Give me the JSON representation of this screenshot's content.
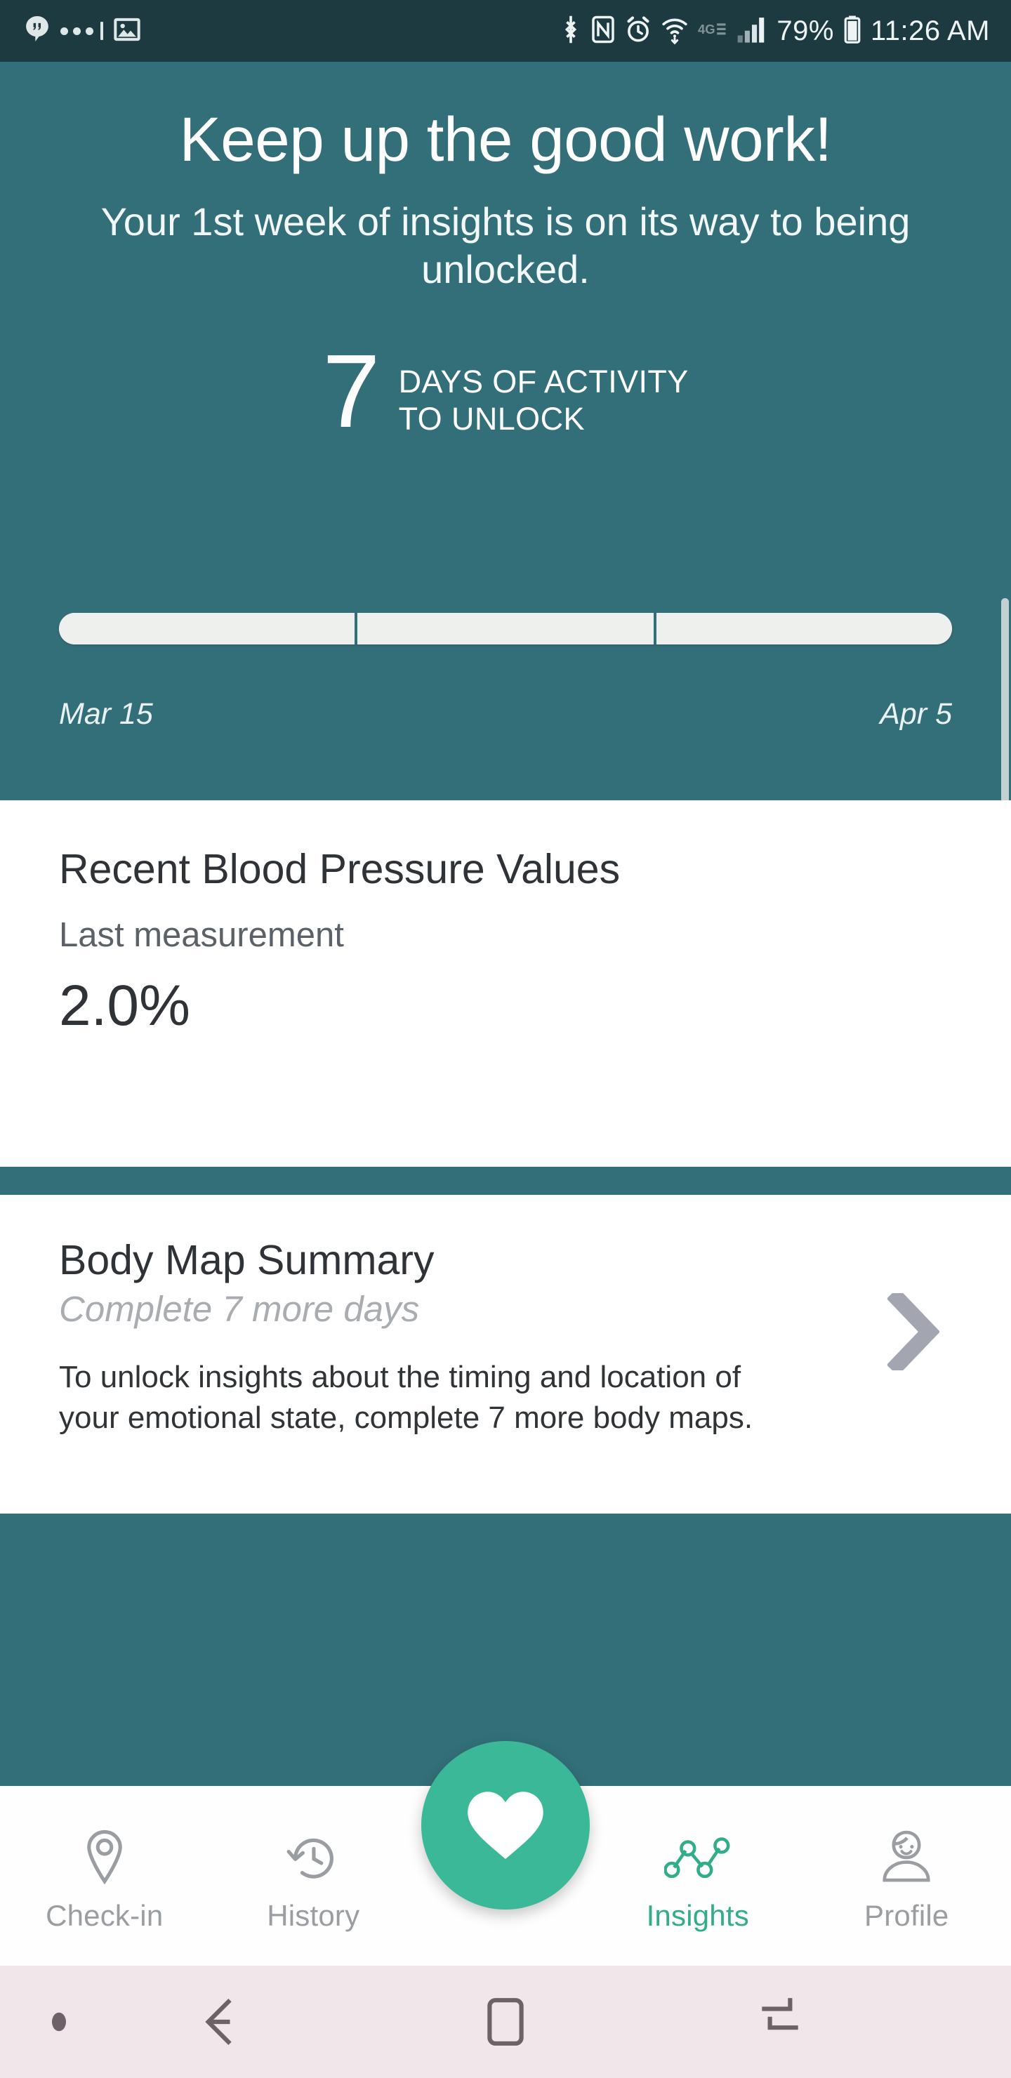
{
  "status_bar": {
    "left_icons": [
      "hangouts-icon",
      "more-dots-icon",
      "gallery-icon"
    ],
    "right_icons": [
      "bluetooth-icon",
      "nfc-icon",
      "alarm-icon",
      "wifi-icon",
      "lte-icon",
      "signal-icon",
      "battery-icon"
    ],
    "network_label": "4G",
    "battery_percent": "79%",
    "clock": "11:26 AM",
    "background_color": "#1d3a40"
  },
  "hero": {
    "title": "Keep up the good work!",
    "subtitle": "Your 1st week of insights is on its way to being unlocked.",
    "unlock_number": "7",
    "unlock_caption_line1": "DAYS OF ACTIVITY",
    "unlock_caption_line2": "TO UNLOCK",
    "progress": {
      "segments": 3,
      "filled": 0,
      "percent": 0,
      "start_date": "Mar 15",
      "end_date": "Apr 5"
    },
    "background_color": "#336f78"
  },
  "cards": {
    "blood_pressure": {
      "title": "Recent Blood Pressure Values",
      "subtitle": "Last measurement",
      "value": "2.0%"
    },
    "body_map": {
      "title": "Body Map Summary",
      "subtitle": "Complete 7 more days",
      "body": "To unlock insights about the timing and location of your emotional state, complete 7 more body maps.",
      "chevron_icon": "chevron-right-icon"
    }
  },
  "tab_bar": {
    "active_color": "#32ad8c",
    "inactive_color": "#9a9ea2",
    "items": [
      {
        "label": "Check-in",
        "icon": "map-pin-icon",
        "active": false
      },
      {
        "label": "History",
        "icon": "clock-rewind-icon",
        "active": false
      },
      {
        "label": "Insights",
        "icon": "line-chart-dots-icon",
        "active": true
      },
      {
        "label": "Profile",
        "icon": "person-avatar-icon",
        "active": false
      }
    ],
    "fab": {
      "icon": "heart-icon",
      "color": "#3bb897"
    }
  },
  "android_nav": {
    "background_color": "#f1e7eb",
    "items": [
      "keyboard-dot-icon",
      "back-icon",
      "home-icon",
      "recents-icon"
    ]
  }
}
